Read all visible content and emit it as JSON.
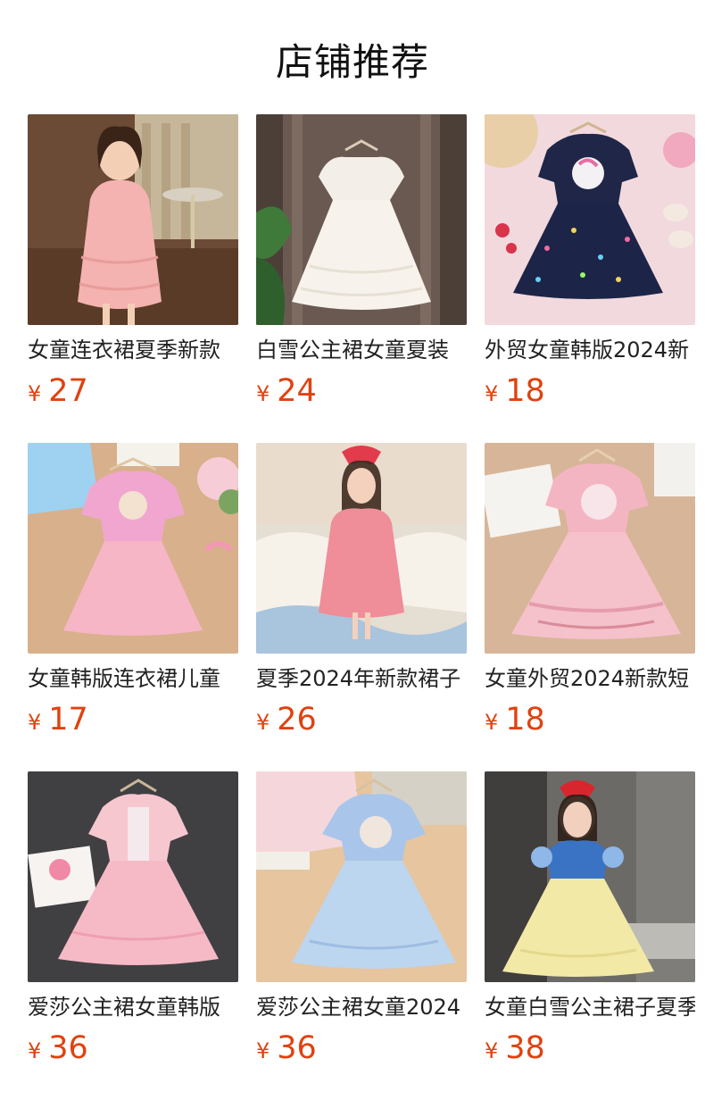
{
  "header": {
    "title": "店铺推荐"
  },
  "products": [
    {
      "name": "女童连衣裙夏季新款",
      "currency": "¥",
      "price": "27",
      "image": "girl in pink tiered dress in room"
    },
    {
      "name": "白雪公主裙女童夏装",
      "currency": "¥",
      "price": "24",
      "image": "white lace dress on hanger"
    },
    {
      "name": "外贸女童韩版2024新",
      "currency": "¥",
      "price": "18",
      "image": "navy unicorn tutu dress"
    },
    {
      "name": "女童韩版连衣裙儿童",
      "currency": "¥",
      "price": "17",
      "image": "pink princess tulle dress flat lay"
    },
    {
      "name": "夏季2024年新款裙子",
      "currency": "¥",
      "price": "26",
      "image": "girl in red dotted puff dress"
    },
    {
      "name": "女童外贸2024新款短",
      "currency": "¥",
      "price": "18",
      "image": "pink unicorn tulle dress"
    },
    {
      "name": "爱莎公主裙女童韩版",
      "currency": "¥",
      "price": "36",
      "image": "pink princess tulle dress on hanger"
    },
    {
      "name": "爱莎公主裙女童2024",
      "currency": "¥",
      "price": "36",
      "image": "blue princess tulle dress"
    },
    {
      "name": "女童白雪公主裙子夏季",
      "currency": "¥",
      "price": "38",
      "image": "girl in snow white costume"
    }
  ]
}
